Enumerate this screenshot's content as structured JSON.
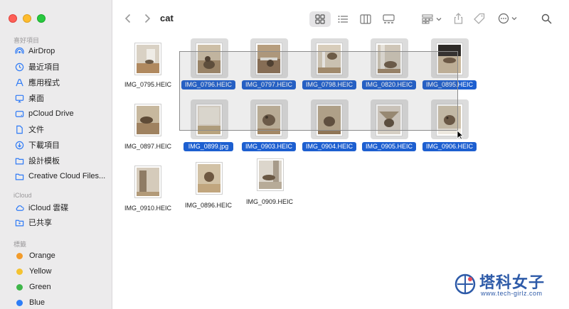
{
  "window": {
    "folder_title": "cat"
  },
  "sidebar": {
    "favorites_title": "喜好項目",
    "favorites": [
      {
        "label": "AirDrop",
        "icon": "airdrop-icon"
      },
      {
        "label": "最近項目",
        "icon": "clock-icon"
      },
      {
        "label": "應用程式",
        "icon": "applications-icon"
      },
      {
        "label": "桌面",
        "icon": "desktop-icon"
      },
      {
        "label": "pCloud Drive",
        "icon": "cloud-drive-icon"
      },
      {
        "label": "文件",
        "icon": "document-icon"
      },
      {
        "label": "下載項目",
        "icon": "download-icon"
      },
      {
        "label": "設計模板",
        "icon": "folder-icon"
      },
      {
        "label": "Creative Cloud Files...",
        "icon": "folder-icon"
      }
    ],
    "icloud_title": "iCloud",
    "icloud": [
      {
        "label": "iCloud 雲碟",
        "icon": "icloud-icon"
      },
      {
        "label": "已共享",
        "icon": "shared-folder-icon"
      }
    ],
    "tags_title": "標籤",
    "tags": [
      {
        "label": "Orange",
        "color": "#f29b2b"
      },
      {
        "label": "Yellow",
        "color": "#f4c331"
      },
      {
        "label": "Green",
        "color": "#3fb64a"
      },
      {
        "label": "Blue",
        "color": "#2d7ef7"
      }
    ]
  },
  "files": [
    {
      "name": "IMG_0795.HEIC",
      "selected": false
    },
    {
      "name": "IMG_0796.HEIC",
      "selected": true
    },
    {
      "name": "IMG_0797.HEIC",
      "selected": true
    },
    {
      "name": "IMG_0798.HEIC",
      "selected": true
    },
    {
      "name": "IMG_0820.HEIC",
      "selected": true
    },
    {
      "name": "IMG_0895.HEIC",
      "selected": true
    },
    {
      "name": "IMG_0897.HEIC",
      "selected": false
    },
    {
      "name": "IMG_0899.jpg",
      "selected": true
    },
    {
      "name": "IMG_0903.HEIC",
      "selected": true
    },
    {
      "name": "IMG_0904.HEIC",
      "selected": true
    },
    {
      "name": "IMG_0905.HEIC",
      "selected": true
    },
    {
      "name": "IMG_0906.HEIC",
      "selected": true
    },
    {
      "name": "IMG_0910.HEIC",
      "selected": false
    },
    {
      "name": "IMG_0896.HEIC",
      "selected": false
    },
    {
      "name": "IMG_0909.HEIC",
      "selected": false
    }
  ],
  "watermark": {
    "title": "塔科女子",
    "url": "www.tech-girlz.com"
  },
  "colors": {
    "selection": "#1d5fd0",
    "sidebar_bg": "#ecebec"
  }
}
